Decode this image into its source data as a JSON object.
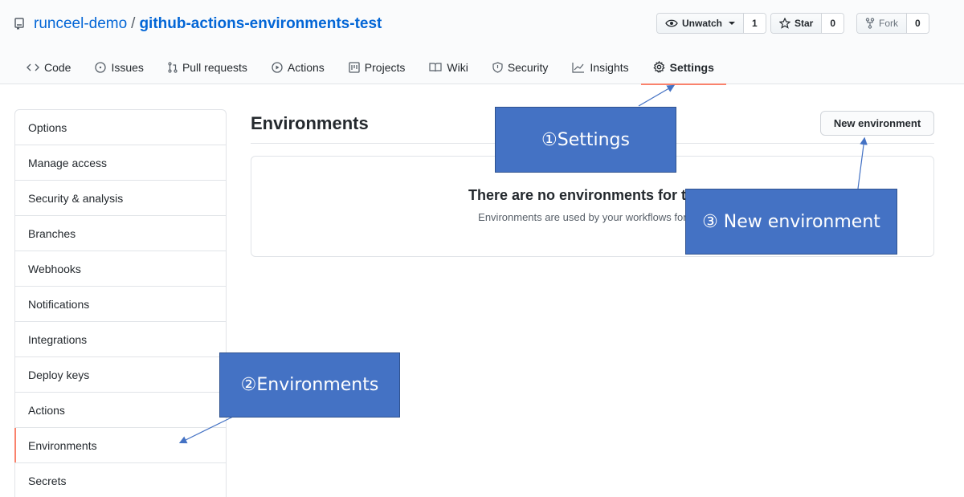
{
  "repo": {
    "owner": "runceel-demo",
    "separator": "/",
    "name": "github-actions-environments-test"
  },
  "header_actions": {
    "unwatch": {
      "label": "Unwatch",
      "count": "1"
    },
    "star": {
      "label": "Star",
      "count": "0"
    },
    "fork": {
      "label": "Fork",
      "count": "0"
    }
  },
  "tabs": [
    {
      "label": "Code",
      "icon": "code-icon"
    },
    {
      "label": "Issues",
      "icon": "issue-icon"
    },
    {
      "label": "Pull requests",
      "icon": "pull-request-icon"
    },
    {
      "label": "Actions",
      "icon": "play-icon"
    },
    {
      "label": "Projects",
      "icon": "project-icon"
    },
    {
      "label": "Wiki",
      "icon": "book-icon"
    },
    {
      "label": "Security",
      "icon": "shield-icon"
    },
    {
      "label": "Insights",
      "icon": "graph-icon"
    },
    {
      "label": "Settings",
      "icon": "gear-icon",
      "selected": true
    }
  ],
  "sidebar": {
    "items": [
      {
        "label": "Options"
      },
      {
        "label": "Manage access"
      },
      {
        "label": "Security & analysis"
      },
      {
        "label": "Branches"
      },
      {
        "label": "Webhooks"
      },
      {
        "label": "Notifications"
      },
      {
        "label": "Integrations"
      },
      {
        "label": "Deploy keys"
      },
      {
        "label": "Actions"
      },
      {
        "label": "Environments",
        "selected": true
      },
      {
        "label": "Secrets"
      }
    ]
  },
  "main": {
    "title": "Environments",
    "new_button": "New environment",
    "blank_title": "There are no environments for this r",
    "blank_desc": "Environments are used by your workflows for dep"
  },
  "annotations": {
    "settings": "①Settings",
    "environments": "②Environments",
    "new_environment": "③ New environment"
  },
  "colors": {
    "accent": "#f9826c",
    "link": "#0366d6",
    "callout": "#4472c4"
  }
}
